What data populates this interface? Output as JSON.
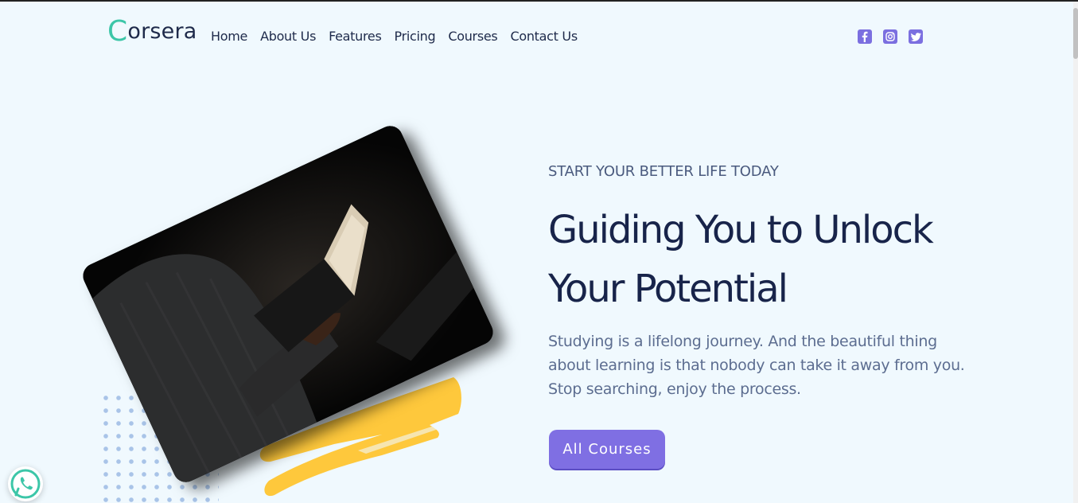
{
  "brand": {
    "logo_initial": "C",
    "logo_rest": "orsera"
  },
  "nav": {
    "items": [
      {
        "label": "Home"
      },
      {
        "label": "About Us"
      },
      {
        "label": "Features"
      },
      {
        "label": "Pricing"
      },
      {
        "label": "Courses"
      },
      {
        "label": "Contact Us"
      }
    ]
  },
  "social": {
    "icons": [
      "facebook-icon",
      "instagram-icon",
      "twitter-icon"
    ],
    "color": "#7b6fe0"
  },
  "hero": {
    "eyebrow": "START YOUR BETTER LIFE TODAY",
    "headline_line1": "Guiding You to Unlock",
    "headline_line2": "Your Potential",
    "description": "Studying is a lifelong journey. And the beautiful thing about learning is that nobody can take it away from you. Stop searching, enjoy the process.",
    "cta_label": "All Courses",
    "image_icon": "person-reading-book-photo"
  },
  "floating": {
    "icon": "whatsapp-icon",
    "color": "#3cc6a8"
  },
  "colors": {
    "background": "#f0f9fe",
    "accent": "#7f6fe3",
    "brand_green": "#3cc6a8",
    "heading": "#18244a",
    "brush_yellow": "#fec83c",
    "dots": "#a9c4e8"
  }
}
